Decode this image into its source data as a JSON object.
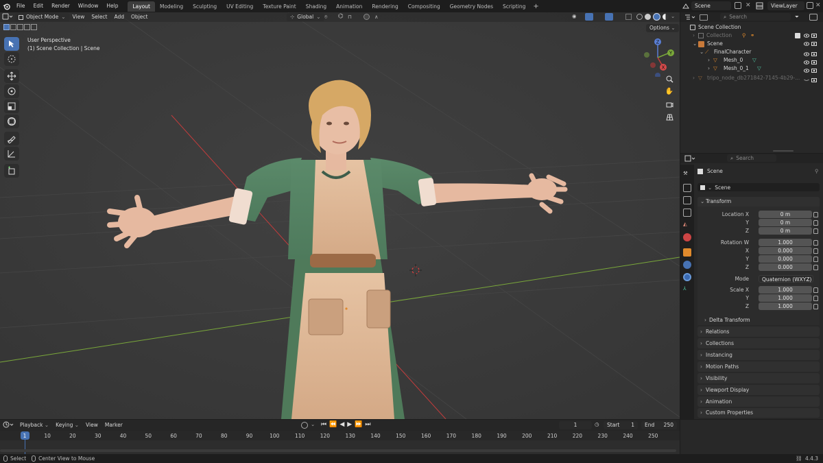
{
  "menu": [
    "File",
    "Edit",
    "Render",
    "Window",
    "Help"
  ],
  "workspaces": [
    "Layout",
    "Modeling",
    "Sculpting",
    "UV Editing",
    "Texture Paint",
    "Shading",
    "Animation",
    "Rendering",
    "Compositing",
    "Geometry Nodes",
    "Scripting"
  ],
  "active_workspace": "Layout",
  "scene_field": "Scene",
  "viewlayer_field": "ViewLayer",
  "viewport": {
    "mode": "Object Mode",
    "menus": [
      "View",
      "Select",
      "Add",
      "Object"
    ],
    "transform_orientation": "Global",
    "options": "Options",
    "overlay_title": "User Perspective",
    "overlay_subtitle": "(1) Scene Collection | Scene",
    "gizmo": {
      "x": "X",
      "y": "Y",
      "z": "Z"
    }
  },
  "outliner": {
    "search_placeholder": "Search",
    "root": "Scene Collection",
    "rows": [
      {
        "label": "Collection",
        "indent": 1,
        "dim": true
      },
      {
        "label": "Scene",
        "indent": 1
      },
      {
        "label": "FinalCharacter",
        "indent": 2
      },
      {
        "label": "Mesh_0",
        "indent": 3
      },
      {
        "label": "Mesh_0_1",
        "indent": 3
      },
      {
        "label": "tripo_node_db271842-7145-4b29-...",
        "indent": 1,
        "dim": true
      }
    ]
  },
  "properties": {
    "search_placeholder": "Search",
    "context": "Scene",
    "object_name": "Scene",
    "transform_panel": "Transform",
    "location": {
      "label_x": "Location X",
      "label_y": "Y",
      "label_z": "Z",
      "x": "0 m",
      "y": "0 m",
      "z": "0 m"
    },
    "rotation": {
      "label_w": "Rotation W",
      "label_x": "X",
      "label_y": "Y",
      "label_z": "Z",
      "w": "1.000",
      "x": "0.000",
      "y": "0.000",
      "z": "0.000"
    },
    "mode_label": "Mode",
    "mode_value": "Quaternion (WXYZ)",
    "scale": {
      "label_x": "Scale X",
      "label_y": "Y",
      "label_z": "Z",
      "x": "1.000",
      "y": "1.000",
      "z": "1.000"
    },
    "delta": "Delta Transform",
    "panels": [
      "Relations",
      "Collections",
      "Instancing",
      "Motion Paths",
      "Visibility",
      "Viewport Display",
      "Animation",
      "Custom Properties"
    ]
  },
  "timeline": {
    "menus": [
      "Playback",
      "Keying",
      "View",
      "Marker"
    ],
    "current_frame": "1",
    "start_label": "Start",
    "start": "1",
    "end_label": "End",
    "end": "250",
    "ticks": [
      "1",
      "10",
      "20",
      "30",
      "40",
      "50",
      "60",
      "70",
      "80",
      "90",
      "100",
      "110",
      "120",
      "130",
      "140",
      "150",
      "160",
      "170",
      "180",
      "190",
      "200",
      "210",
      "220",
      "230",
      "240",
      "250"
    ]
  },
  "status": {
    "select": "Select",
    "center": "Center View to Mouse",
    "version": "4.4.3"
  },
  "colors": {
    "accent": "#4772b3",
    "viewport_bg": "#3c3c3c",
    "panel_bg": "#282828",
    "x_axis": "#c43c3c",
    "y_axis": "#7aa83a"
  }
}
